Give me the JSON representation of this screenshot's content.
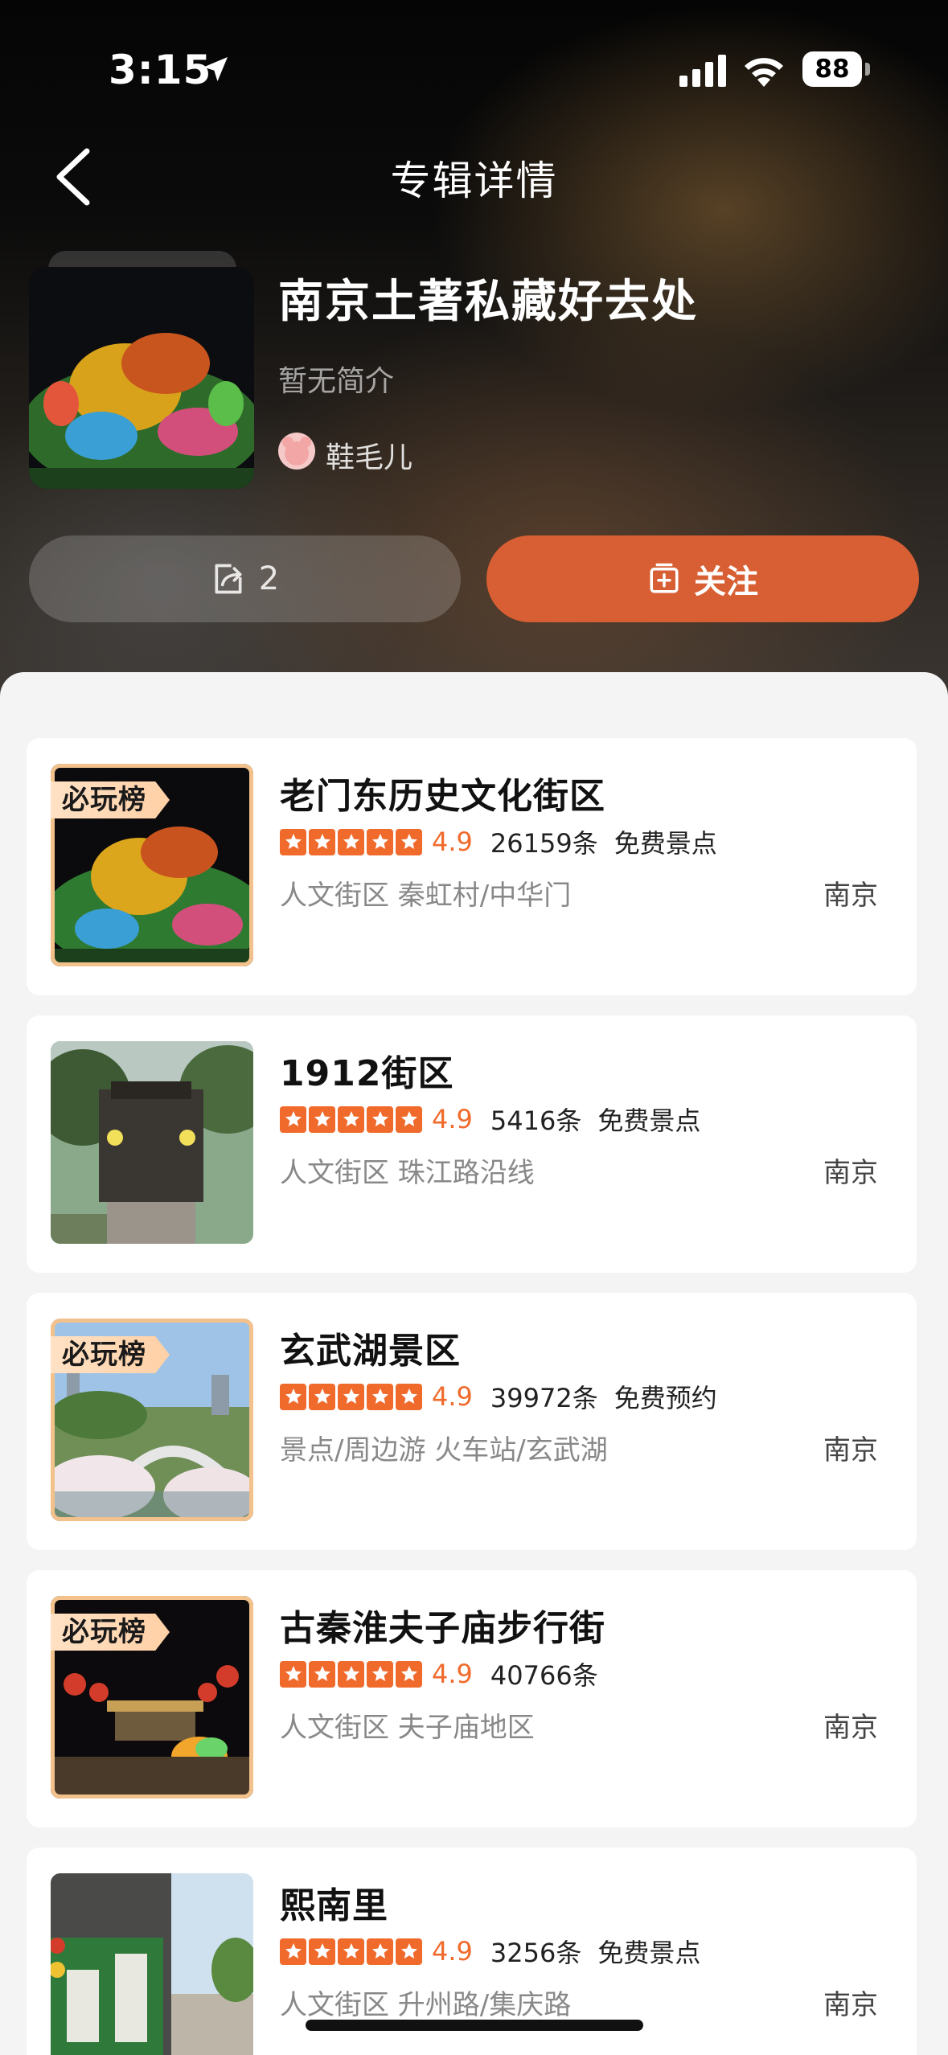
{
  "status_bar": {
    "time": "3:15",
    "battery": "88"
  },
  "header": {
    "title": "专辑详情"
  },
  "album": {
    "title": "南京土著私藏好去处",
    "intro": "暂无简介",
    "author": "鞋毛儿",
    "share_count": "2",
    "follow_label": "关注"
  },
  "colors": {
    "accent": "#d85f33",
    "star": "#f06a2c"
  },
  "rank_badge_label": "必玩榜",
  "items": [
    {
      "name": "老门东历史文化街区",
      "score": "4.9",
      "reviews": "26159条",
      "tag": "免费景点",
      "category": "人文街区 秦虹村/中华门",
      "city": "南京",
      "ranked": true
    },
    {
      "name": "1912街区",
      "score": "4.9",
      "reviews": "5416条",
      "tag": "免费景点",
      "category": "人文街区 珠江路沿线",
      "city": "南京",
      "ranked": false
    },
    {
      "name": "玄武湖景区",
      "score": "4.9",
      "reviews": "39972条",
      "tag": "免费预约",
      "category": "景点/周边游 火车站/玄武湖",
      "city": "南京",
      "ranked": true
    },
    {
      "name": "古秦淮夫子庙步行街",
      "score": "4.9",
      "reviews": "40766条",
      "tag": "",
      "category": "人文街区 夫子庙地区",
      "city": "南京",
      "ranked": true
    },
    {
      "name": "熙南里",
      "score": "4.9",
      "reviews": "3256条",
      "tag": "免费景点",
      "category": "人文街区 升州路/集庆路",
      "city": "南京",
      "ranked": false
    }
  ]
}
